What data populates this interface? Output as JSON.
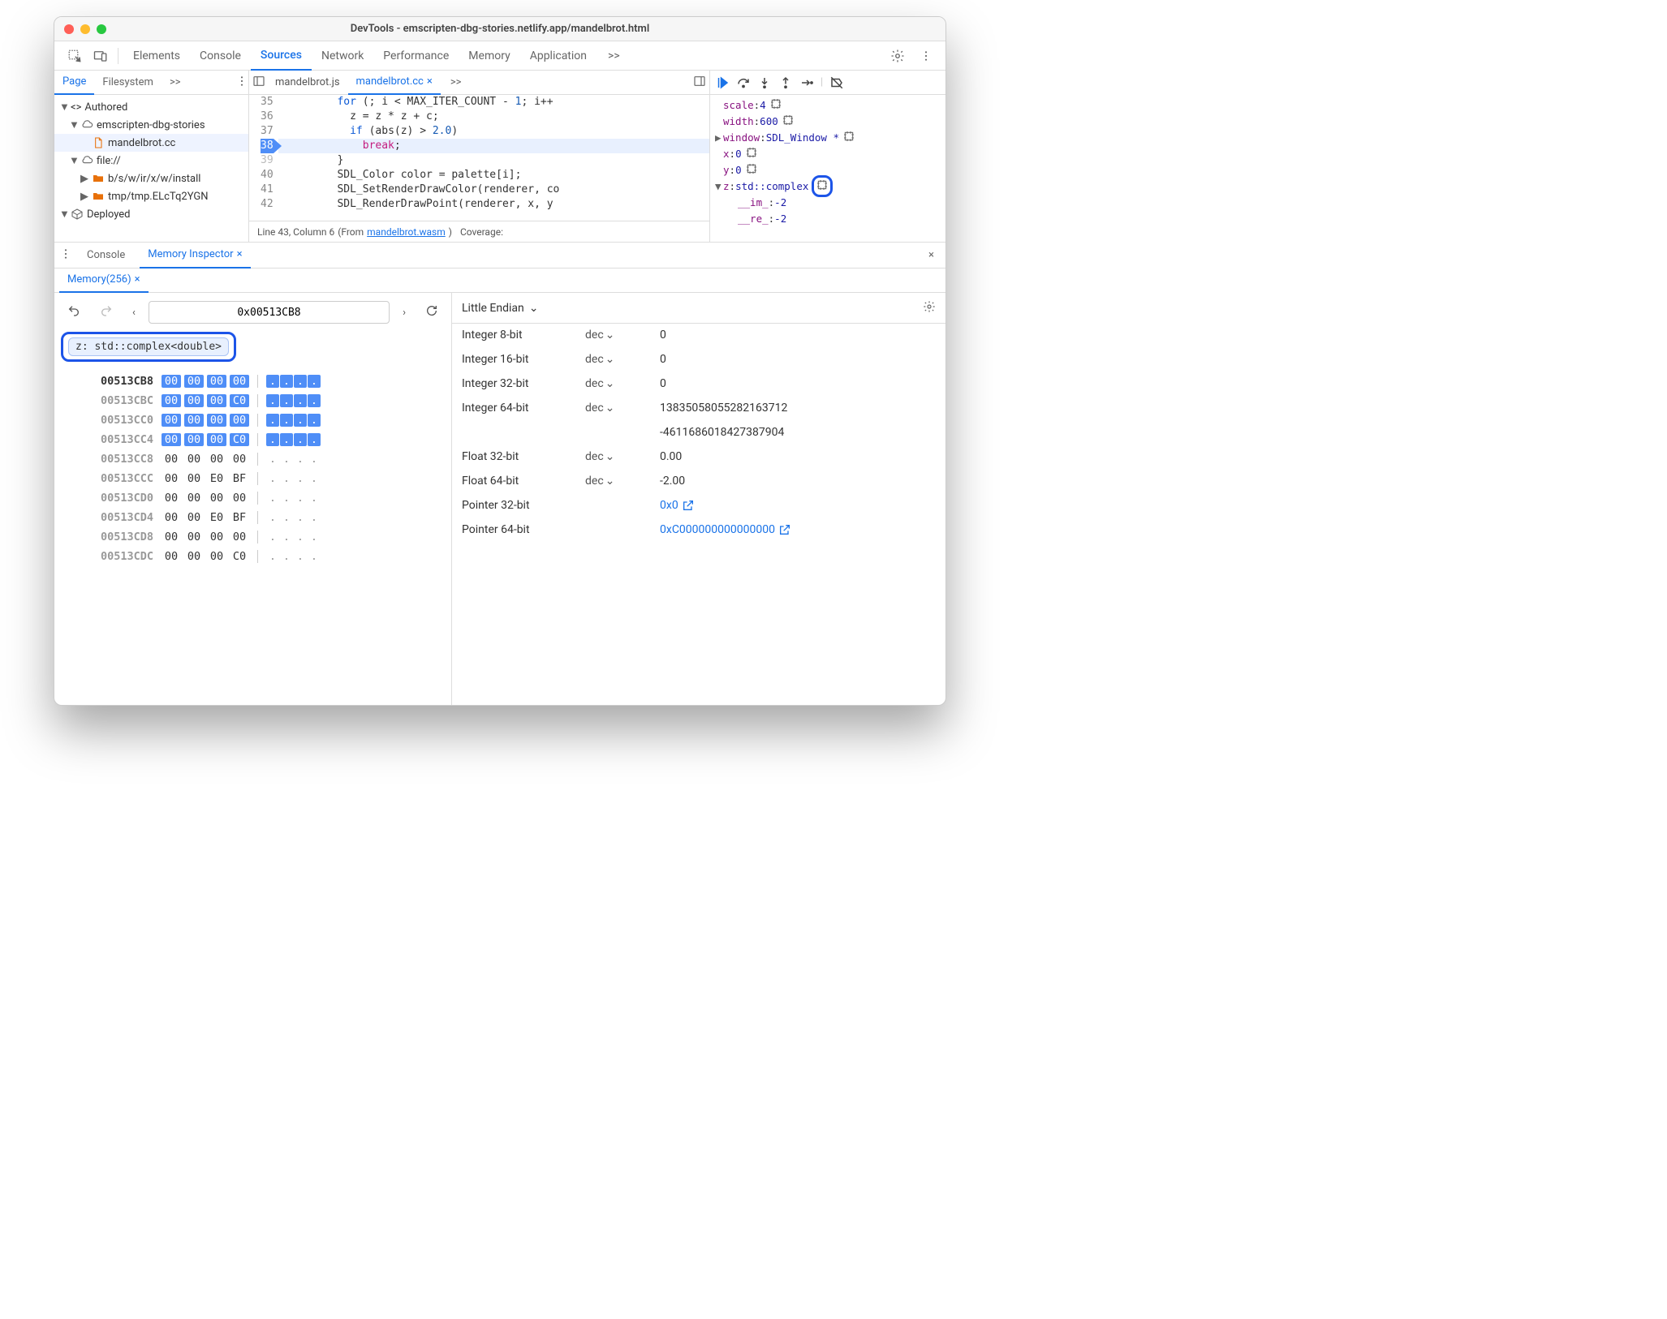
{
  "window": {
    "title": "DevTools - emscripten-dbg-stories.netlify.app/mandelbrot.html"
  },
  "mainTabs": {
    "items": [
      "Elements",
      "Console",
      "Sources",
      "Network",
      "Performance",
      "Memory",
      "Application"
    ],
    "overflow": ">>",
    "activeIndex": 2
  },
  "sidebar": {
    "tabs": [
      "Page",
      "Filesystem"
    ],
    "overflow": ">>",
    "tree": {
      "authored": "Authored",
      "domain": "emscripten-dbg-stories",
      "file": "mandelbrot.cc",
      "fileScheme": "file://",
      "path1": "b/s/w/ir/x/w/install",
      "path2": "tmp/tmp.ELcTq2YGN",
      "deployed": "Deployed"
    }
  },
  "editor": {
    "tabs": [
      {
        "label": "mandelbrot.js",
        "active": false,
        "close": false
      },
      {
        "label": "mandelbrot.cc",
        "active": true,
        "close": true
      }
    ],
    "overflow": ">>",
    "lines": [
      {
        "n": 35,
        "html": "       <span class='kw'>for</span> (; i < MAX_ITER_COUNT - <span class='num'>1</span>; i++"
      },
      {
        "n": 36,
        "html": "         z = z * z + c;"
      },
      {
        "n": 37,
        "html": "         <span class='kw'>if</span> (abs(z) > <span class='num'>2.0</span>)"
      },
      {
        "n": 38,
        "hl": true,
        "html": "           <span class='mag'>break</span>;"
      },
      {
        "n": 39,
        "fade": true,
        "html": "       }"
      },
      {
        "n": 40,
        "html": "       <span class='fn'>SDL_Color</span> color = palette[i];"
      },
      {
        "n": 41,
        "html": "       <span class='fn'>SDL_SetRenderDrawColor</span>(renderer, co"
      },
      {
        "n": 42,
        "html": "       <span class='fn'>SDL_RenderDrawPoint</span>(renderer, x, y"
      }
    ],
    "status": {
      "pos": "Line 43, Column 6",
      "fromText": "(From ",
      "fromLink": "mandelbrot.wasm",
      "closeParen": ")",
      "coverage": "Coverage:"
    }
  },
  "debugger": {
    "scope": [
      {
        "k": "scale",
        "v": "4",
        "chip": true
      },
      {
        "k": "width",
        "v": "600",
        "chip": true
      },
      {
        "k": "window",
        "v": "SDL_Window *",
        "chip": true,
        "arrow": "▶"
      },
      {
        "k": "x",
        "v": "0",
        "chip": true
      },
      {
        "k": "y",
        "v": "0",
        "chip": true
      },
      {
        "k": "z",
        "v": "std::complex<double>",
        "chip": true,
        "arrow": "▼",
        "callout": true
      },
      {
        "k": "__im_",
        "v": "-2",
        "child": true
      },
      {
        "k": "__re_",
        "v": "-2",
        "child": true
      }
    ]
  },
  "drawer": {
    "tabs": [
      "Console",
      "Memory Inspector"
    ],
    "activeIndex": 1,
    "subtab": "Memory(256)"
  },
  "memoryInspector": {
    "address": "0x00513CB8",
    "chip": "z: std::complex<double>",
    "rows": [
      {
        "addr": "00513CB8",
        "bold": true,
        "bytes": [
          "00",
          "00",
          "00",
          "00"
        ],
        "hl": true
      },
      {
        "addr": "00513CBC",
        "bytes": [
          "00",
          "00",
          "00",
          "C0"
        ],
        "hl": true
      },
      {
        "addr": "00513CC0",
        "bytes": [
          "00",
          "00",
          "00",
          "00"
        ],
        "hl": true
      },
      {
        "addr": "00513CC4",
        "bytes": [
          "00",
          "00",
          "00",
          "C0"
        ],
        "hl": true
      },
      {
        "addr": "00513CC8",
        "bytes": [
          "00",
          "00",
          "00",
          "00"
        ]
      },
      {
        "addr": "00513CCC",
        "bytes": [
          "00",
          "00",
          "E0",
          "BF"
        ]
      },
      {
        "addr": "00513CD0",
        "bytes": [
          "00",
          "00",
          "00",
          "00"
        ]
      },
      {
        "addr": "00513CD4",
        "bytes": [
          "00",
          "00",
          "E0",
          "BF"
        ]
      },
      {
        "addr": "00513CD8",
        "bytes": [
          "00",
          "00",
          "00",
          "00"
        ]
      },
      {
        "addr": "00513CDC",
        "bytes": [
          "00",
          "00",
          "00",
          "C0"
        ]
      }
    ],
    "endian": "Little Endian",
    "values": [
      {
        "label": "Integer 8-bit",
        "mode": "dec",
        "val": "0"
      },
      {
        "label": "Integer 16-bit",
        "mode": "dec",
        "val": "0"
      },
      {
        "label": "Integer 32-bit",
        "mode": "dec",
        "val": "0"
      },
      {
        "label": "Integer 64-bit",
        "mode": "dec",
        "val": "13835058055282163712",
        "val2": "-4611686018427387904"
      },
      {
        "label": "Float 32-bit",
        "mode": "dec",
        "val": "0.00"
      },
      {
        "label": "Float 64-bit",
        "mode": "dec",
        "val": "-2.00"
      },
      {
        "label": "Pointer 32-bit",
        "mode": "",
        "val": "0x0",
        "link": true
      },
      {
        "label": "Pointer 64-bit",
        "mode": "",
        "val": "0xC000000000000000",
        "link": true
      }
    ]
  }
}
